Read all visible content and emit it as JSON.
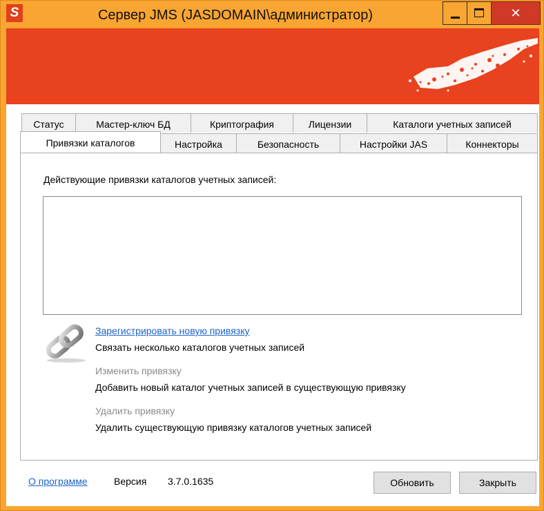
{
  "window": {
    "title": "Сервер JMS (JASDOMAIN\\администратор)",
    "app_icon": "S"
  },
  "tabs_row1": [
    {
      "label": "Статус"
    },
    {
      "label": "Мастер-ключ БД"
    },
    {
      "label": "Криптография"
    },
    {
      "label": "Лицензии"
    },
    {
      "label": "Каталоги учетных записей"
    }
  ],
  "tabs_row2": [
    {
      "label": "Привязки каталогов",
      "active": true
    },
    {
      "label": "Настройка"
    },
    {
      "label": "Безопасность"
    },
    {
      "label": "Настройки JAS"
    },
    {
      "label": "Коннекторы"
    }
  ],
  "panel": {
    "label": "Действующие привязки каталогов учетных записей:",
    "actions": [
      {
        "link": "Зарегистрировать новую привязку",
        "description": "Связать несколько каталогов учетных записей",
        "enabled": true
      },
      {
        "link": "Изменить привязку",
        "description": "Добавить новый каталог учетных записей в существующую привязку",
        "enabled": false
      },
      {
        "link": "Удалить привязку",
        "description": "Удалить существующую привязку каталогов учетных записей",
        "enabled": false
      }
    ]
  },
  "footer": {
    "about_link": "О программе",
    "version_label": "Версия",
    "version_value": "3.7.0.1635",
    "refresh_button": "Обновить",
    "close_button": "Закрыть"
  },
  "colors": {
    "banner": "#e8421f",
    "titlebar": "#f9a531",
    "link": "#1a63c9"
  },
  "icons": [
    "app-icon",
    "minimize-icon",
    "maximize-icon",
    "close-icon",
    "chain-link-icon"
  ]
}
